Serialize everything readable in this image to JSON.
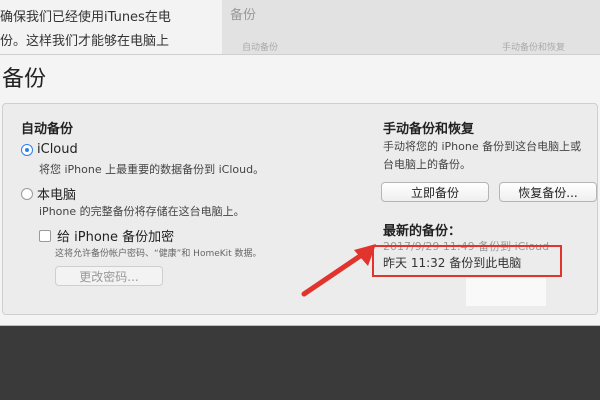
{
  "background": {
    "article_line1": "确保我们已经使用iTunes在电",
    "article_line2": "份。这样我们才能够在电脑上",
    "right_title": "备份",
    "right_sub1": "自动备份",
    "right_sub2": "手动备份和恢复"
  },
  "sheet": {
    "title": "备份"
  },
  "auto_backup": {
    "section_title": "自动备份",
    "icloud_label": "iCloud",
    "icloud_desc": "将您 iPhone 上最重要的数据备份到 iCloud。",
    "computer_label": "本电脑",
    "computer_desc": "iPhone 的完整备份将存储在这台电脑上。",
    "encrypt_label": "给 iPhone 备份加密",
    "encrypt_desc": "这将允许备份帐户密码、“健康”和 HomeKit 数据。",
    "change_password_label": "更改密码..."
  },
  "manual_backup": {
    "section_title": "手动备份和恢复",
    "desc_line1": "手动将您的 iPhone 备份到这台电脑上或",
    "desc_line2": "台电脑上的备份。",
    "backup_now_label": "立即备份",
    "restore_label": "恢复备份..."
  },
  "latest_backup": {
    "title": "最新的备份：",
    "icloud_entry": "2017/9/29 11:49 备份到 iCloud",
    "computer_entry": "昨天 11:32 备份到此电脑"
  },
  "colors": {
    "annotation_red": "#e0342c",
    "selected_blue": "#2a7ff0"
  }
}
